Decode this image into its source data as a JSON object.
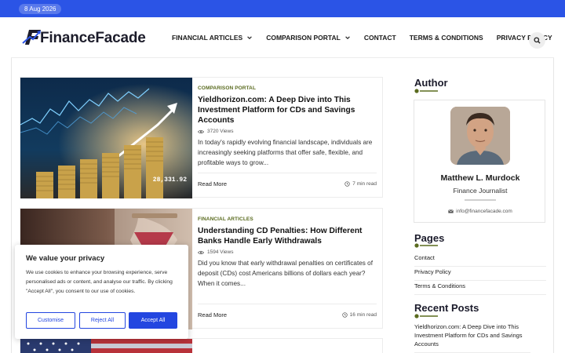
{
  "topbar": {
    "date": "8 Aug 2026"
  },
  "brand": {
    "logo_text": "FinanceFacade"
  },
  "nav": {
    "items": [
      {
        "label": "FINANCIAL ARTICLES"
      },
      {
        "label": "COMPARISON PORTAL"
      },
      {
        "label": "CONTACT"
      },
      {
        "label": "TERMS & CONDITIONS"
      },
      {
        "label": "PRIVACY POLICY"
      }
    ]
  },
  "posts": [
    {
      "category": "COMPARISON PORTAL",
      "title": "Yieldhorizon.com: A Deep Dive into This Investment Platform for CDs and Savings Accounts",
      "views": "3720 Views",
      "excerpt": "In today's rapidly evolving financial landscape, individuals are increasingly seeking platforms that offer safe, flexible, and profitable ways to grow...",
      "read_more": "Read More",
      "read_time": "7 min read",
      "image_caption": "28,331.92"
    },
    {
      "category": "FINANCIAL ARTICLES",
      "title": "Understanding CD Penalties: How Different Banks Handle Early Withdrawals",
      "views": "1594 Views",
      "excerpt": "Did you know that early withdrawal penalties on certificates of deposit (CDs) cost Americans billions of dollars each year? When it comes...",
      "read_more": "Read More",
      "read_time": "16 min read"
    }
  ],
  "sidebar": {
    "author_heading": "Author",
    "author": {
      "name": "Matthew L. Murdock",
      "role": "Finance Journalist",
      "email": "info@financefacade.com"
    },
    "pages_heading": "Pages",
    "pages": [
      {
        "label": "Contact"
      },
      {
        "label": "Privacy Policy"
      },
      {
        "label": "Terms & Conditions"
      }
    ],
    "recent_heading": "Recent Posts",
    "recent": [
      {
        "label": "Yieldhorizon.com: A Deep Dive into This Investment Platform for CDs and Savings Accounts"
      }
    ]
  },
  "cookie": {
    "title": "We value your privacy",
    "text": "We use cookies to enhance your browsing experience, serve personalised ads or content, and analyse our traffic. By clicking \"Accept All\", you consent to our use of cookies.",
    "customise": "Customise",
    "reject": "Reject All",
    "accept": "Accept All"
  },
  "colors": {
    "topbar": "#2b54e6",
    "accent_green": "#5a6b1f",
    "button_blue": "#2346e0"
  }
}
